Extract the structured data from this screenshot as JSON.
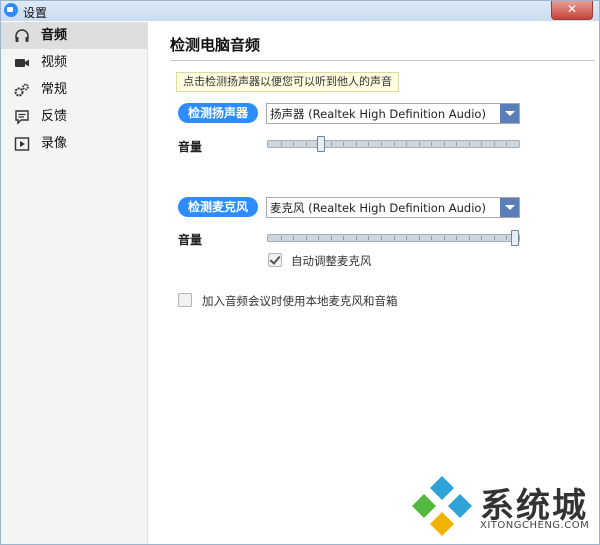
{
  "window": {
    "title": "设置",
    "close": "✕"
  },
  "sidebar": {
    "items": [
      {
        "label": "音频",
        "icon": "headphones-icon",
        "active": true
      },
      {
        "label": "视频",
        "icon": "camera-icon",
        "active": false
      },
      {
        "label": "常规",
        "icon": "gears-icon",
        "active": false
      },
      {
        "label": "反馈",
        "icon": "comment-icon",
        "active": false
      },
      {
        "label": "录像",
        "icon": "record-icon",
        "active": false
      }
    ]
  },
  "main": {
    "heading": "检测电脑音频",
    "tooltip": "点击检测扬声器以便您可以听到他人的声音",
    "speaker": {
      "button": "检测扬声器",
      "select_value": "扬声器 (Realtek High Definition Audio)",
      "volume_label": "音量",
      "volume_level": 0.2
    },
    "mic": {
      "button": "检测麦克风",
      "select_value": "麦克风 (Realtek High Definition Audio)",
      "volume_label": "音量",
      "volume_level": 1.0,
      "auto_adjust_label": "自动调整麦克风",
      "auto_adjust_checked": true
    },
    "join_audio": {
      "label": "加入音频会议时使用本地麦克风和音箱",
      "checked": false
    }
  },
  "watermark": {
    "text": "系统城",
    "sub": "XITONGCHENG.COM"
  },
  "colors": {
    "accent": "#2d8cff",
    "dropdown": "#5a7fb8"
  }
}
